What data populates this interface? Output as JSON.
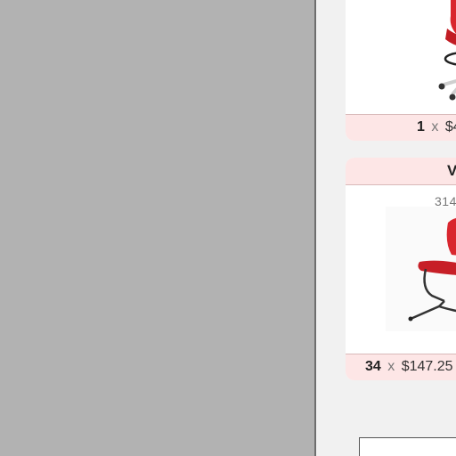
{
  "products": [
    {
      "name": "",
      "sku": "",
      "quantity": "1",
      "price": "$4",
      "image_icon": "red-drafting-stool-image"
    },
    {
      "name": "V",
      "sku": "314",
      "quantity": "34",
      "price": "$147.25",
      "image_icon": "red-cantilever-chair-image"
    }
  ],
  "times_symbol": "x"
}
